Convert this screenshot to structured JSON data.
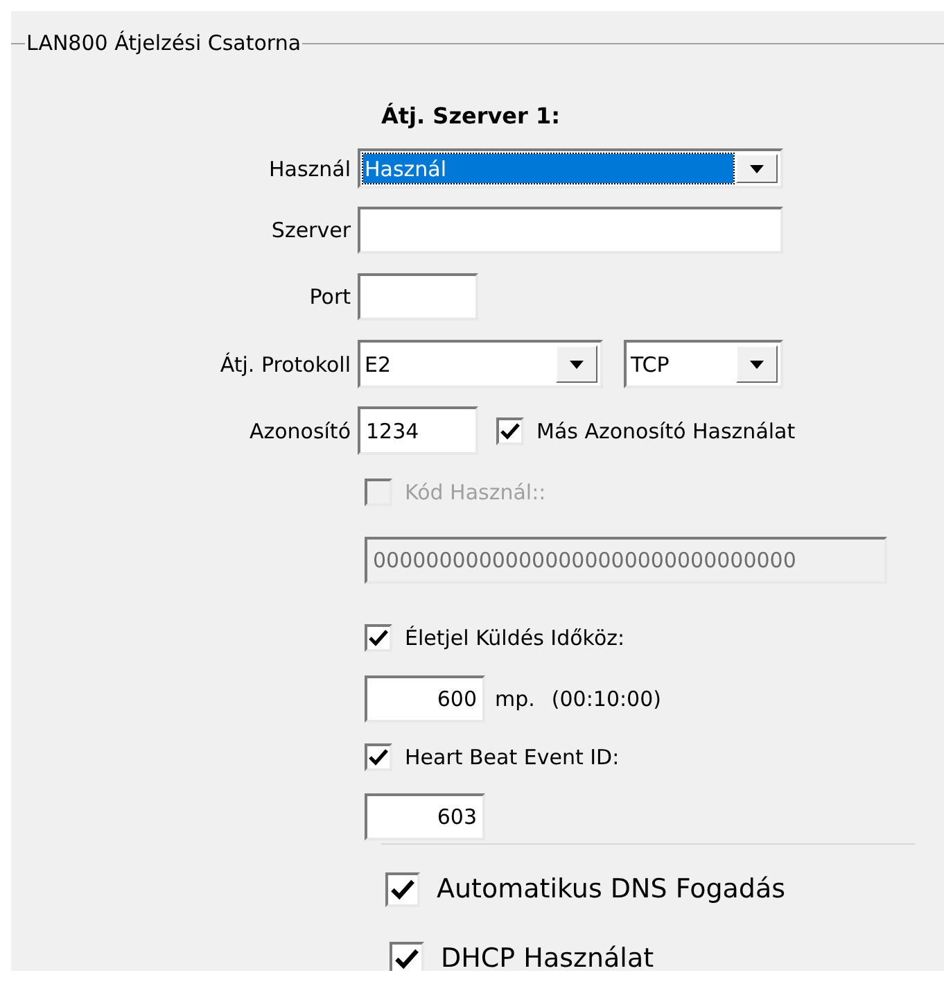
{
  "group": {
    "title": "LAN800 Átjelzési Csatorna"
  },
  "section_heading": "Átj. Szerver 1:",
  "use": {
    "label": "Használ",
    "value": "Használ",
    "highlighted": true
  },
  "server": {
    "label": "Szerver"
  },
  "port": {
    "label": "Port"
  },
  "protocol": {
    "label": "Átj. Protokoll",
    "value": "E2",
    "transport": "TCP"
  },
  "identifier": {
    "label": "Azonosító",
    "value": "1234",
    "other_id": {
      "label": "Más Azonosító Használat",
      "checked": true
    }
  },
  "code": {
    "label": "Kód Használ::",
    "checked": false,
    "disabled": true,
    "value": "00000000000000000000000000000000"
  },
  "heartbeat_interval": {
    "label": "Életjel Küldés Időköz:",
    "checked": true,
    "value": "600",
    "unit": "mp.",
    "duration": "(00:10:00)"
  },
  "heartbeat_event": {
    "label": "Heart Beat Event ID:",
    "checked": true,
    "value": "603"
  },
  "auto_dns": {
    "label": "Automatikus DNS Fogadás",
    "checked": true
  },
  "dhcp": {
    "label": "DHCP Használat",
    "checked": true
  }
}
